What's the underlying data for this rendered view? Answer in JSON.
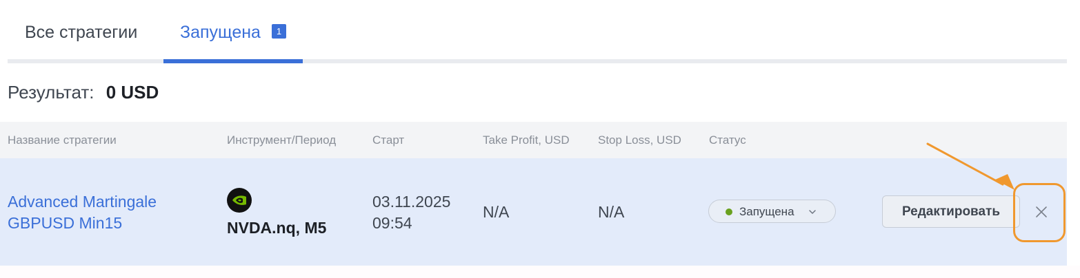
{
  "tabs": [
    {
      "label": "Все стратегии",
      "active": false
    },
    {
      "label": "Запущена",
      "active": true,
      "badge": "1"
    }
  ],
  "result": {
    "label": "Результат:",
    "value": "0 USD"
  },
  "table": {
    "columns": [
      "Название стратегии",
      "Инструмент/Период",
      "Старт",
      "Take Profit, USD",
      "Stop Loss, USD",
      "Статус"
    ],
    "rows": [
      {
        "name": "Advanced Martingale\nGBPUSD Min15",
        "instrument_icon": "nvidia-logo-icon",
        "instrument": "NVDA.nq, M5",
        "start": "03.11.2025\n09:54",
        "take_profit": "N/A",
        "stop_loss": "N/A",
        "status": "Запущена",
        "edit_label": "Редактировать"
      }
    ]
  },
  "colors": {
    "accent": "#3a6fd8",
    "row_highlight": "#e3ebfa",
    "status_running": "#6aa11f",
    "annotation": "#f0982e"
  },
  "icons": {
    "status_chevron": "chevron-down-icon",
    "close": "close-icon",
    "annotation": "arrow-icon"
  }
}
